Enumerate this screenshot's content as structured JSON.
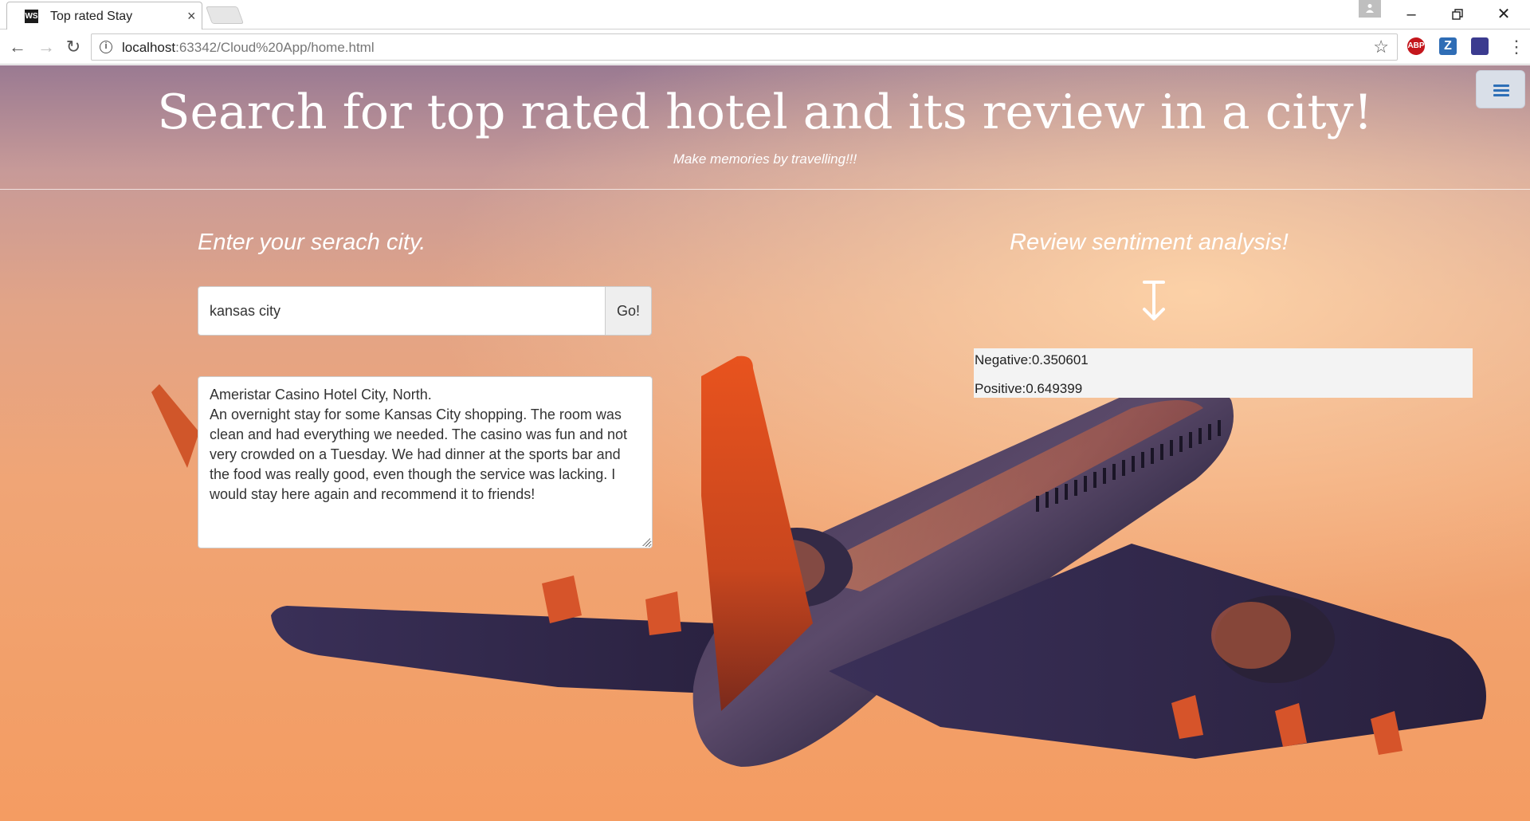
{
  "browser": {
    "tab_title": "Top rated Stay",
    "tab_favicon": "WS",
    "url_host": "localhost",
    "url_rest": ":63342/Cloud%20App/home.html",
    "extensions": [
      {
        "name": "adblock-plus-icon",
        "label": "ABP",
        "color": "#c4161c"
      },
      {
        "name": "zotero-icon",
        "label": "Z",
        "color": "#2f6db5"
      },
      {
        "name": "extension-icon",
        "label": "",
        "color": "#3b3b8f"
      }
    ]
  },
  "page": {
    "title": "Search for top rated hotel and its review in a city!",
    "subtitle": "Make memories by travelling!!!",
    "left_heading": "Enter your serach city.",
    "search_value": "kansas city",
    "go_label": "Go!",
    "review_hotel": "Ameristar Casino Hotel City, North.",
    "review_text": "An overnight stay for some Kansas City shopping. The room was clean and had everything we needed. The casino was fun and not very crowded on a Tuesday. We had dinner at the sports bar and the food was really good, even though the service was lacking. I would stay here again and recommend it to friends!",
    "right_heading": "Review sentiment analysis!",
    "negative": "Negative:0.350601",
    "positive": "Positive:0.649399"
  }
}
